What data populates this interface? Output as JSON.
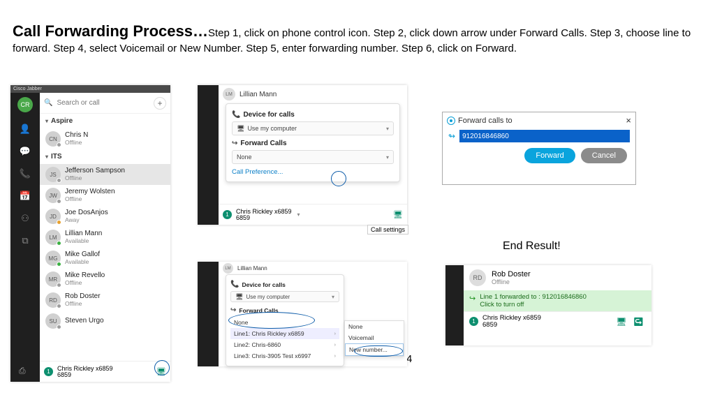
{
  "heading": {
    "lead": "Call Forwarding Process…",
    "rest": "Step 1, click on phone control icon. Step 2, click down arrow under Forward Calls. Step 3, choose line to forward. Step 4, select Voicemail or New Number.  Step 5, enter forwarding number.  Step 6, click on Forward."
  },
  "steps": {
    "s1": "Step 1",
    "s2": "Step 2",
    "s3": "Step 3",
    "s4": "Step 4",
    "s5": "Step 5",
    "s6": "Step 6 -->",
    "end": "End Result!"
  },
  "jabber": {
    "app_title": "Cisco Jabber",
    "search_placeholder": "Search or call",
    "avatar_initials": "CR",
    "groups": {
      "g1": "Aspire",
      "g2": "ITS"
    },
    "contacts": [
      {
        "ini": "CN",
        "name": "Chris N",
        "status": "Offline",
        "dot": "gray"
      },
      {
        "ini": "JS",
        "name": "Jefferson Sampson",
        "status": "Offline",
        "dot": "gray",
        "sel": true
      },
      {
        "ini": "JW",
        "name": "Jeremy Wolsten",
        "status": "Offline",
        "dot": "gray"
      },
      {
        "ini": "JD",
        "name": "Joe DosAnjos",
        "status": "Away",
        "dot": "orange"
      },
      {
        "ini": "LM",
        "name": "Lillian Mann",
        "status": "Available",
        "dot": "green"
      },
      {
        "ini": "MG",
        "name": "Mike Gallof",
        "status": "Available",
        "dot": "green"
      },
      {
        "ini": "MR",
        "name": "Mike Revello",
        "status": "Offline",
        "dot": "gray"
      },
      {
        "ini": "RD",
        "name": "Rob Doster",
        "status": "Offline",
        "dot": "gray"
      },
      {
        "ini": "SU",
        "name": "Steven Urgo",
        "status": "",
        "dot": "gray"
      }
    ],
    "footer": {
      "badge": "1",
      "line": "Chris Rickley x6859",
      "ext": "6859"
    }
  },
  "popover": {
    "header_name": "Lillian Mann",
    "header_ini": "LM",
    "device_title": "Device for calls",
    "device_value": "Use my computer",
    "forward_title": "Forward Calls",
    "forward_value": "None",
    "pref_link": "Call Preference...",
    "footer": {
      "badge": "1",
      "line": "Chris Rickley x6859",
      "ext": "6859"
    },
    "tooltip": "Call settings"
  },
  "lines": {
    "header_name": "Lillian Mann",
    "header_ini": "LM",
    "device_title": "Device for calls",
    "device_value": "Use my computer",
    "forward_title": "Forward Calls",
    "forward_value": "None",
    "rows": [
      "Line1: Chris Rickley x6859",
      "Line2: Chris-6860",
      "Line3: Chris-3905 Test x6997"
    ],
    "sub": [
      "None",
      "Voicemail",
      "New number..."
    ]
  },
  "dialog": {
    "title": "Forward calls to",
    "value": "912016846860",
    "forward": "Forward",
    "cancel": "Cancel"
  },
  "result": {
    "contact": {
      "ini": "RD",
      "name": "Rob Doster",
      "status": "Offline"
    },
    "msg_l1": "Line 1 forwarded to  : 912016846860",
    "msg_l2": "Click to turn off",
    "footer": {
      "badge": "1",
      "line": "Chris Rickley x6859",
      "ext": "6859"
    }
  }
}
